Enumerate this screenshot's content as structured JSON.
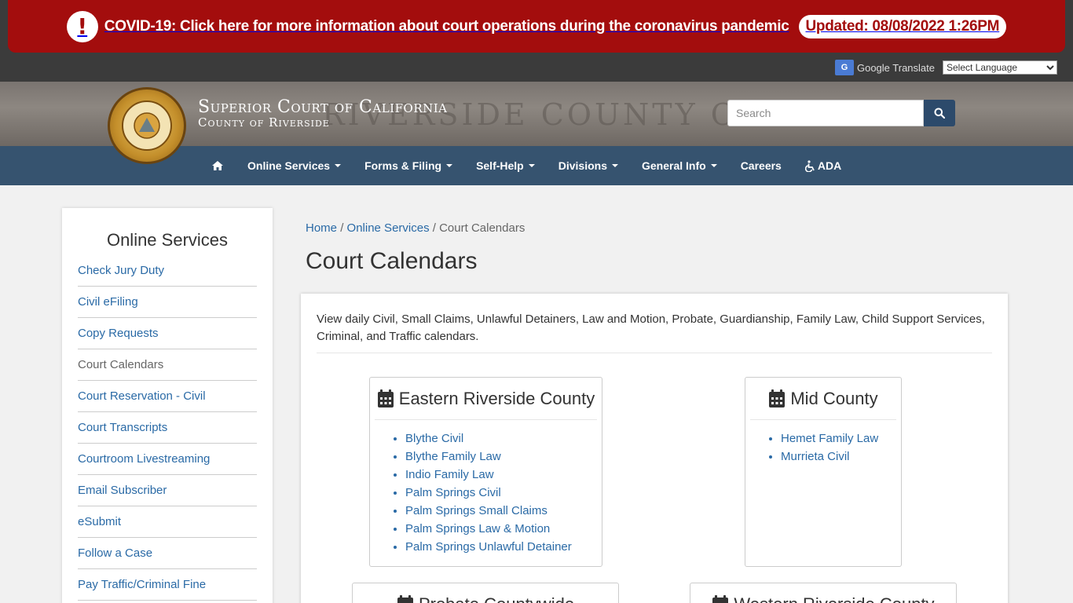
{
  "alert": {
    "message": "COVID-19: Click here for more information about court operations during the coronavirus pandemic",
    "updated": "Updated: 08/08/2022 1:26PM",
    "icon": "exclamation-icon",
    "color": "#a30d0d"
  },
  "translate": {
    "label": "Google Translate",
    "select_value": "Select Language"
  },
  "header": {
    "title_line1": "Superior Court of California",
    "title_line2": "County of Riverside",
    "bg_text": "RIVERSIDE COUNTY CO"
  },
  "search": {
    "placeholder": "Search"
  },
  "nav": {
    "items": [
      {
        "label": "Online Services"
      },
      {
        "label": "Forms & Filing"
      },
      {
        "label": "Self-Help"
      },
      {
        "label": "Divisions"
      },
      {
        "label": "General Info"
      },
      {
        "label": "Careers"
      },
      {
        "label": "ADA"
      }
    ]
  },
  "sidebar": {
    "title": "Online Services",
    "items": [
      {
        "label": "Check Jury Duty"
      },
      {
        "label": "Civil eFiling"
      },
      {
        "label": "Copy Requests"
      },
      {
        "label": "Court Calendars"
      },
      {
        "label": "Court Reservation - Civil"
      },
      {
        "label": "Court Transcripts"
      },
      {
        "label": "Courtroom Livestreaming"
      },
      {
        "label": "Email Subscriber"
      },
      {
        "label": "eSubmit"
      },
      {
        "label": "Follow a Case"
      },
      {
        "label": "Pay Traffic/Criminal Fine"
      }
    ]
  },
  "breadcrumb": {
    "home": "Home",
    "section": "Online Services",
    "sep": "/",
    "current": "Court Calendars"
  },
  "main": {
    "title": "Court Calendars",
    "intro": "View daily Civil, Small Claims, Unlawful Detainers, Law and Motion, Probate, Guardianship, Family Law, Child Support Services, Criminal, and Traffic calendars."
  },
  "cards": {
    "eastern": {
      "title": "Eastern Riverside County",
      "links": [
        "Blythe Civil",
        "Blythe Family Law",
        "Indio Family Law",
        "Palm Springs Civil",
        "Palm Springs Small Claims",
        "Palm Springs Law & Motion",
        "Palm Springs Unlawful Detainer"
      ]
    },
    "mid": {
      "title": "Mid County",
      "links": [
        "Hemet Family Law",
        "Murrieta Civil"
      ]
    },
    "probate": {
      "title": "Probate Countywide"
    },
    "western": {
      "title": "Western Riverside County"
    }
  }
}
